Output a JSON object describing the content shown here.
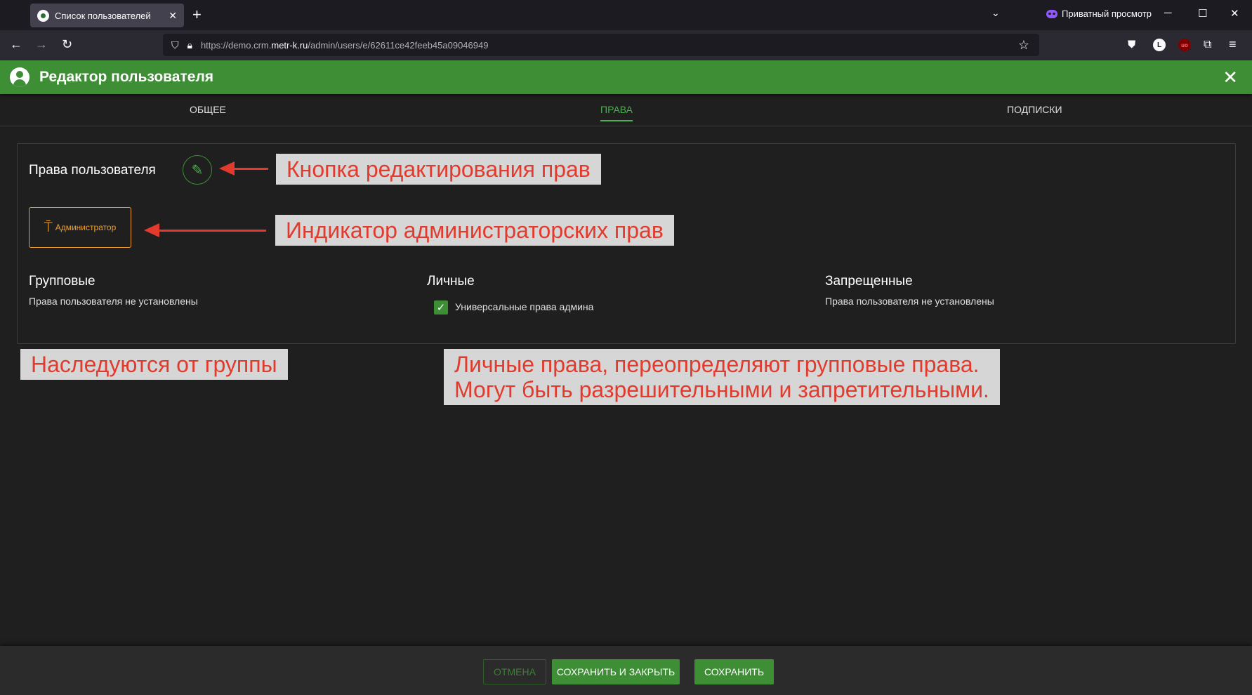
{
  "browser": {
    "tab_title": "Список пользователей",
    "tab_close": "✕",
    "new_tab": "+",
    "private_label": "Приватный просмотр",
    "url_prefix": "https://demo.crm.",
    "url_domain": "metr-k.ru",
    "url_path": "/admin/users/e/62611ce42feeb45a09046949",
    "extension_badges": [
      "L",
      "uo"
    ]
  },
  "header": {
    "title": "Редактор пользователя",
    "close": "✕"
  },
  "tabs": [
    {
      "label": "ОБЩЕЕ",
      "active": false
    },
    {
      "label": "ПРАВА",
      "active": true
    },
    {
      "label": "ПОДПИСКИ",
      "active": false
    }
  ],
  "rights": {
    "title": "Права пользователя",
    "edit_icon": "✎",
    "admin_badge": "Администратор",
    "columns": [
      {
        "title": "Групповые",
        "text": "Права пользователя не установлены"
      },
      {
        "title": "Личные",
        "checkbox_label": "Универсальные права админа",
        "checked": true
      },
      {
        "title": "Запрещенные",
        "text": "Права пользователя не установлены"
      }
    ]
  },
  "annotations": {
    "edit_button": "Кнопка редактирования прав",
    "admin_indicator": "Индикатор администраторских прав",
    "inherited": "Наследуются от группы",
    "personal_line1": "Личные права, переопределяют групповые права.",
    "personal_line2": "Могут быть разрешительными и запретительными."
  },
  "footer": {
    "cancel": "ОТМЕНА",
    "save_close": "СОХРАНИТЬ И ЗАКРЫТЬ",
    "save": "СОХРАНИТЬ"
  },
  "colors": {
    "accent_green": "#3e8e36",
    "admin_orange": "#f0a030",
    "annotation_red": "#e23b2e"
  }
}
